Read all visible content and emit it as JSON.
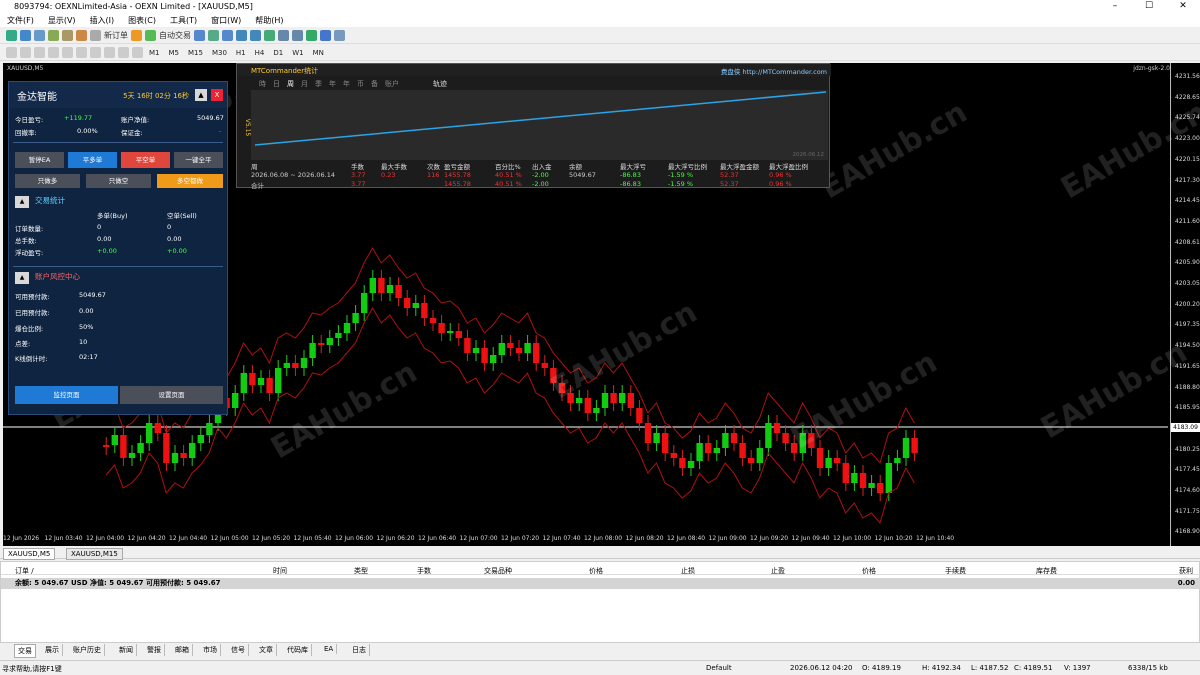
{
  "window": {
    "title": "8093794: OEXNLimited-Asia - OEXN Limited - [XAUUSD,M5]",
    "min": "–",
    "max": "☐",
    "close": "✕"
  },
  "menu": [
    "文件(F)",
    "显示(V)",
    "插入(I)",
    "图表(C)",
    "工具(T)",
    "窗口(W)",
    "帮助(H)"
  ],
  "toolbar1": {
    "new_order": "新订单",
    "auto_trade": "自动交易"
  },
  "toolbar2": {
    "timeframes": [
      "M1",
      "M5",
      "M15",
      "M30",
      "H1",
      "H4",
      "D1",
      "W1",
      "MN"
    ]
  },
  "chart": {
    "symbol_tf": "XAUUSD,M5",
    "indicator_label": "jdzn-gsk-2.0",
    "current_price": "4183.09",
    "price_ticks": [
      "4231.56",
      "4228.65",
      "4225.74",
      "4223.00",
      "4220.15",
      "4217.30",
      "4214.45",
      "4211.60",
      "4208.61",
      "4205.90",
      "4203.05",
      "4200.20",
      "4197.35",
      "4194.50",
      "4191.65",
      "4188.80",
      "4185.95",
      "4183.09",
      "4180.25",
      "4177.45",
      "4174.60",
      "4171.75",
      "4168.90"
    ],
    "time_ticks": [
      "12 Jun 2026",
      "12 Jun 03:40",
      "12 Jun 04:00",
      "12 Jun 04:20",
      "12 Jun 04:40",
      "12 Jun 05:00",
      "12 Jun 05:20",
      "12 Jun 05:40",
      "12 Jun 06:00",
      "12 Jun 06:20",
      "12 Jun 06:40",
      "12 Jun 07:00",
      "12 Jun 07:20",
      "12 Jun 07:40",
      "12 Jun 08:00",
      "12 Jun 08:20",
      "12 Jun 08:40",
      "12 Jun 09:00",
      "12 Jun 09:20",
      "12 Jun 09:40",
      "12 Jun 10:00",
      "12 Jun 10:20",
      "12 Jun 10:40"
    ],
    "watermark": "EAHub.cn"
  },
  "ea_panel": {
    "name": "金达智能",
    "countdown": "5天 16时 02分 16秒",
    "collapse": "▲",
    "close": "X",
    "today_profit_label": "今日盈亏:",
    "today_profit": "+119.77",
    "equity_label": "账户净值:",
    "equity": "5049.67",
    "drawdown_label": "回撤率:",
    "drawdown": "0.00%",
    "margin_label": "保证金:",
    "margin": "-",
    "buttons": [
      "暂停EA",
      "平多单",
      "平空单",
      "一键全平",
      "只做多",
      "只做空",
      "多空都做"
    ],
    "trade_stats_title": "交易统计",
    "col_buy": "多单(Buy)",
    "col_sell": "空单(Sell)",
    "stats": [
      {
        "label": "订单数量:",
        "buy": "0",
        "sell": "0"
      },
      {
        "label": "总手数:",
        "buy": "0.00",
        "sell": "0.00"
      },
      {
        "label": "浮动盈亏:",
        "buy": "+0.00",
        "sell": "+0.00"
      }
    ],
    "risk_title": "账户风控中心",
    "risk": [
      {
        "label": "可用预付款:",
        "value": "5049.67"
      },
      {
        "label": "已用预付款:",
        "value": "0.00"
      },
      {
        "label": "爆仓比例:",
        "value": "50%"
      },
      {
        "label": "点差:",
        "value": "10"
      },
      {
        "label": "K线倒计时:",
        "value": "02:17"
      }
    ],
    "footer_buttons": [
      "监控页面",
      "设置页面"
    ]
  },
  "mtc": {
    "title": "MTCommander统计",
    "link": "费盘侠 http://MTCommander.com",
    "side_label": "V5.15",
    "tabs": [
      "時",
      "日",
      "周",
      "月",
      "季",
      "年",
      "年",
      "币",
      "备",
      "账户"
    ],
    "curve_label": "轨迹",
    "curve_date": "2026.06.12",
    "headers": [
      "周",
      "手数",
      "最大手数",
      "次数",
      "盈亏金额",
      "百分比%",
      "出入金",
      "余额",
      "最大浮亏",
      "最大浮亏比例",
      "最大浮盈金额",
      "最大浮盈比例"
    ],
    "row1": [
      "2026.06.08 ~ 2026.06.14",
      "3.77",
      "0.23",
      "116",
      "1455.78",
      "40.51 %",
      "-2.00",
      "5049.67",
      "-86.83",
      "-1.59 %",
      "52.37",
      "0.96 %"
    ],
    "row2": [
      "合计",
      "3.77",
      "",
      "",
      "1455.78",
      "40.51 %",
      "-2.00",
      "",
      "-86.83",
      "-1.59 %",
      "52.37",
      "0.96 %"
    ]
  },
  "chart_tabs": [
    "XAUUSD,M5",
    "XAUUSD,M15"
  ],
  "terminal": {
    "columns": [
      "订单 /",
      "时间",
      "类型",
      "手数",
      "交易品种",
      "价格",
      "止损",
      "止盈",
      "价格",
      "手续费",
      "库存费",
      "获利"
    ],
    "balance_line": "余额: 5 049.67 USD  净值: 5 049.67  可用预付款: 5 049.67",
    "balance_profit": "0.00",
    "tabs": [
      "交易",
      "展示",
      "账户历史",
      "新闻",
      "警报",
      "邮箱",
      "市场",
      "信号",
      "文章",
      "代码库",
      "EA",
      "日志"
    ]
  },
  "status": {
    "help": "寻求帮助,请按F1键",
    "profile": "Default",
    "datetime": "2026.06.12 04:20",
    "open": "O: 4189.19",
    "high": "H: 4192.34",
    "low": "L: 4187.52",
    "close": "C: 4189.51",
    "volume": "V: 1397",
    "traffic": "6338/15 kb"
  }
}
